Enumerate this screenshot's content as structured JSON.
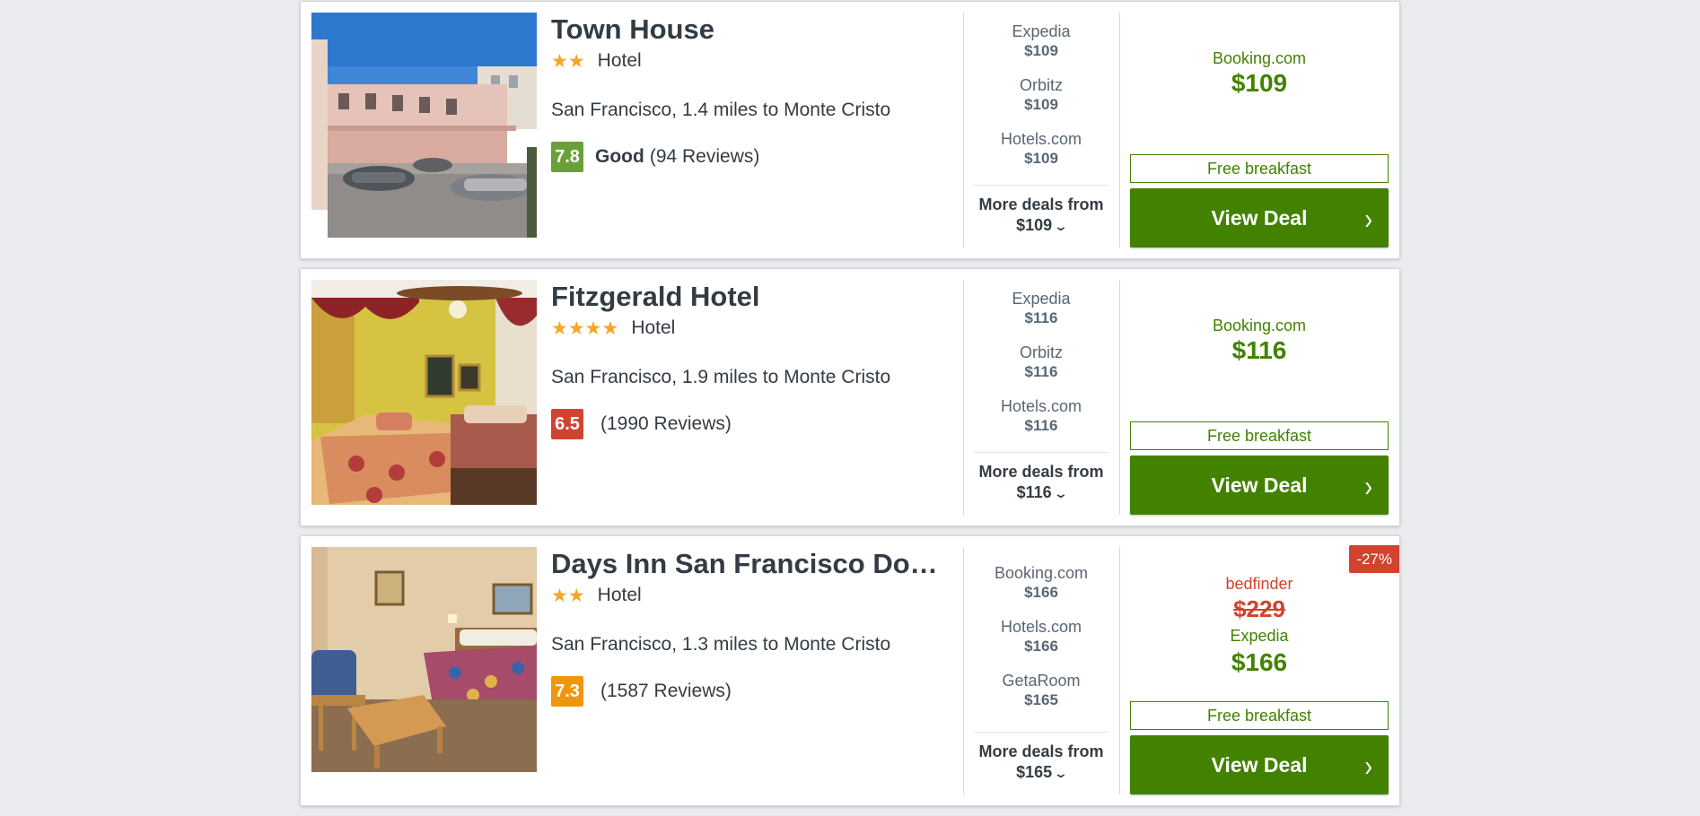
{
  "hotels": [
    {
      "name": "Town House",
      "stars": "★★",
      "type": "Hotel",
      "location": "San Francisco, 1.4 miles to Monte Cristo",
      "score": "7.8",
      "score_color": "#6aa03a",
      "rating_word": "Good",
      "reviews": "(94 Reviews)",
      "deals": [
        {
          "provider": "Expedia",
          "price": "$109"
        },
        {
          "provider": "Orbitz",
          "price": "$109"
        },
        {
          "provider": "Hotels.com",
          "price": "$109"
        }
      ],
      "more_label": "More deals from",
      "more_price": "$109",
      "best_provider": "Booking.com",
      "best_price": "$109",
      "perk": "Free breakfast",
      "cta": "View Deal"
    },
    {
      "name": "Fitzgerald Hotel",
      "stars": "★★★★",
      "type": "Hotel",
      "location": "San Francisco, 1.9 miles to Monte Cristo",
      "score": "6.5",
      "score_color": "#d0432e",
      "rating_word": "",
      "reviews": "(1990 Reviews)",
      "deals": [
        {
          "provider": "Expedia",
          "price": "$116"
        },
        {
          "provider": "Orbitz",
          "price": "$116"
        },
        {
          "provider": "Hotels.com",
          "price": "$116"
        }
      ],
      "more_label": "More deals from",
      "more_price": "$116",
      "best_provider": "Booking.com",
      "best_price": "$116",
      "perk": "Free breakfast",
      "cta": "View Deal"
    },
    {
      "name": "Days Inn San Francisco Dow…",
      "stars": "★★",
      "type": "Hotel",
      "location": "San Francisco, 1.3 miles to Monte Cristo",
      "score": "7.3",
      "score_color": "#f0960e",
      "rating_word": "",
      "reviews": "(1587 Reviews)",
      "deals": [
        {
          "provider": "Booking.com",
          "price": "$166"
        },
        {
          "provider": "Hotels.com",
          "price": "$166"
        },
        {
          "provider": "GetaRoom",
          "price": "$165"
        }
      ],
      "more_label": "More deals from",
      "more_price": "$165",
      "badge": "-27%",
      "old_provider": "bedfinder",
      "old_price": "$229",
      "best_provider": "Expedia",
      "best_price": "$166",
      "perk": "Free breakfast",
      "cta": "View Deal"
    }
  ],
  "icons": {
    "chevron": "⌄",
    "arrow": "›"
  }
}
